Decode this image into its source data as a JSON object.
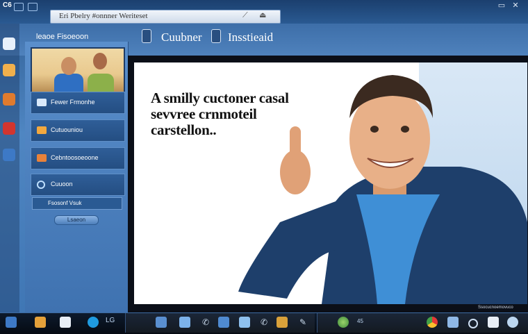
{
  "window": {
    "app_logo": "C6",
    "title": "Eri Pbelry #onnner Weriteset"
  },
  "sidebar": {
    "title": "leaoe Fisoeoon",
    "items": [
      {
        "label": "Fewer Frmonhe"
      },
      {
        "label": "Cutuouniou"
      },
      {
        "label": "Cebntoosoeoone"
      },
      {
        "label": "Cuuoon"
      }
    ],
    "selected_row": "Fsosonf Vsuk",
    "button_label": "Lsaeon"
  },
  "header": {
    "label_left": "Cuubner",
    "label_right": "Insstieaid"
  },
  "slide": {
    "text_line1": "A smilly cuctoner casal",
    "text_line2": "sevvree crnmoteil",
    "text_line3": "carstellon.."
  },
  "viewer": {
    "caption": "Ssocucnoemovuco"
  },
  "taskbar": {
    "label": "LG",
    "label2": "45"
  },
  "colors": {
    "accent": "#3f72b0",
    "taskbar": "#0d1a2c",
    "hoodie": "#1e3f6b",
    "shirt": "#3f8fd6"
  }
}
